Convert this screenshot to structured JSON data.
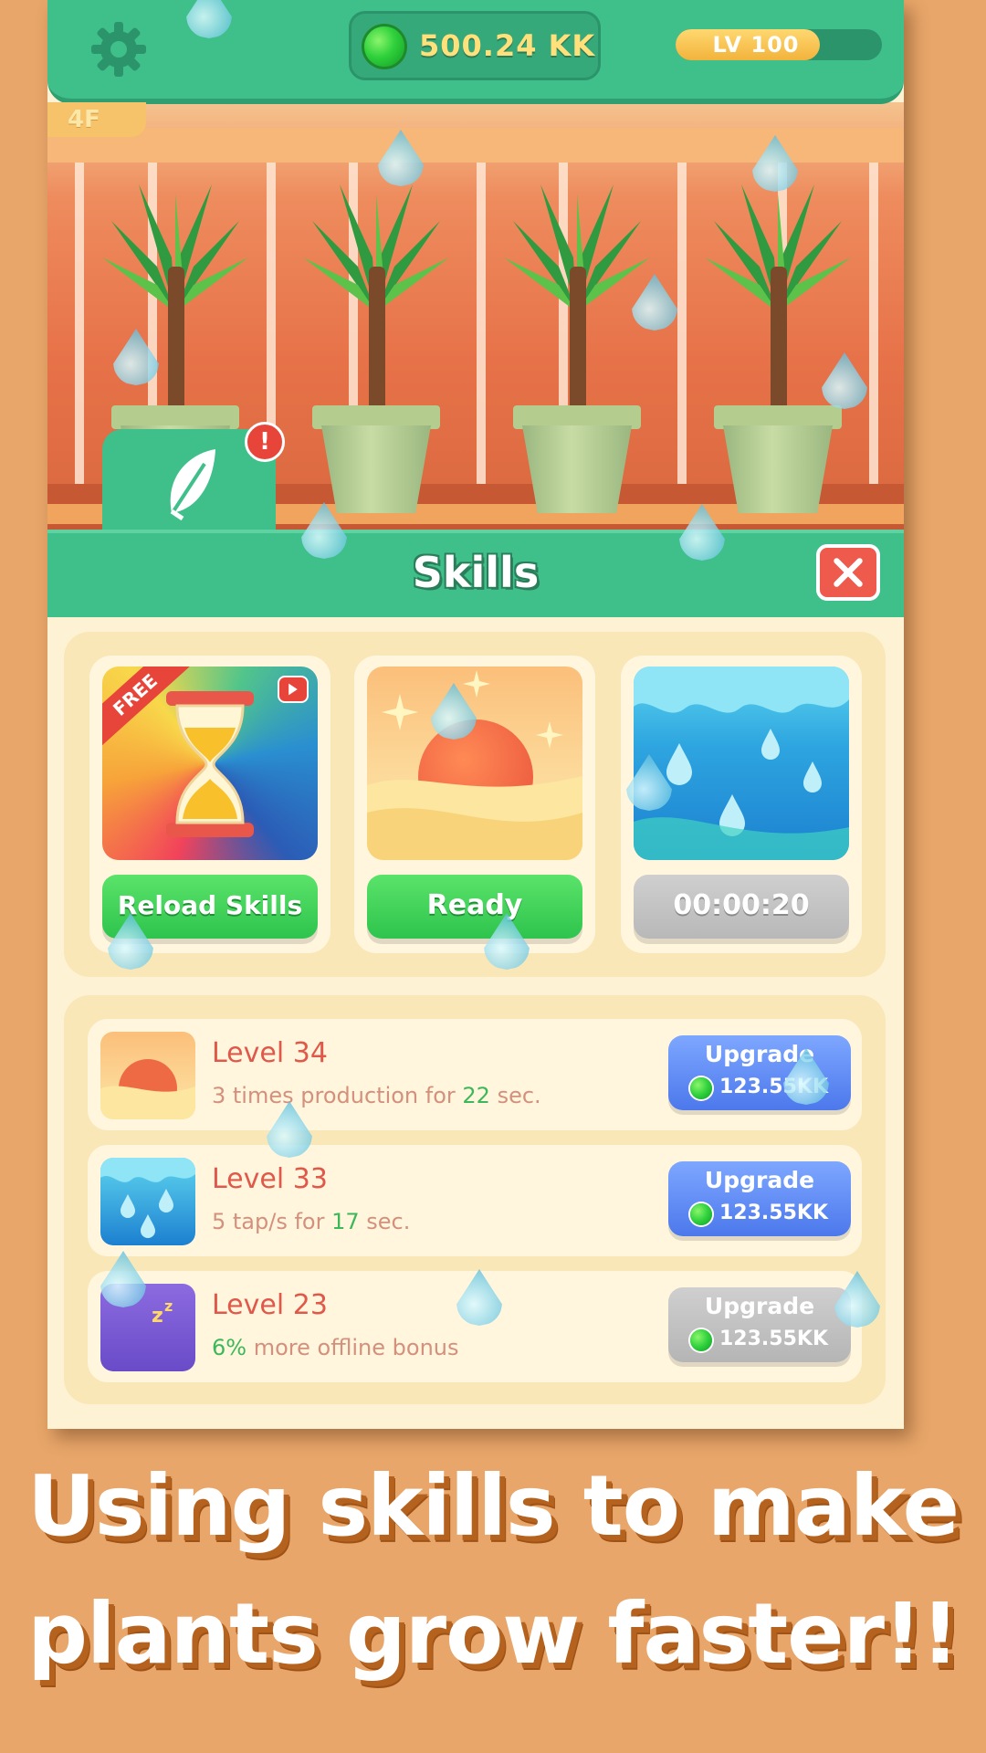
{
  "topbar": {
    "settings_icon": "gear-icon",
    "currency_value": "500.24 KK",
    "level_label": "LV 100",
    "level_progress": 0.7
  },
  "floor": {
    "label": "4F"
  },
  "skills_header": {
    "title": "Skills",
    "close_icon": "close-icon",
    "tab_icon": "leaf-icon",
    "alert": "!"
  },
  "skill_cards": [
    {
      "name": "reload-skills",
      "ribbon": "FREE",
      "button_label": "Reload Skills",
      "state": "active"
    },
    {
      "name": "sun-skill",
      "button_label": "Ready",
      "state": "active"
    },
    {
      "name": "rain-skill",
      "button_label": "00:00:20",
      "state": "cooldown"
    }
  ],
  "upgrades": [
    {
      "level": "Level 34",
      "desc_prefix": "3 times production for ",
      "desc_value": "22",
      "desc_suffix": " sec.",
      "button_label": "Upgrade",
      "cost": "123.55KK",
      "state": "enabled"
    },
    {
      "level": "Level 33",
      "desc_prefix": "5 tap/s for ",
      "desc_value": "17",
      "desc_suffix": " sec.",
      "button_label": "Upgrade",
      "cost": "123.55KK",
      "state": "enabled"
    },
    {
      "level": "Level 23",
      "desc_prefix": "",
      "desc_value": "6%",
      "desc_suffix": " more offline bonus",
      "button_label": "Upgrade",
      "cost": "123.55KK",
      "state": "disabled"
    }
  ],
  "caption": {
    "line1": "Using skills to make",
    "line2": "plants grow faster!!"
  },
  "colors": {
    "background": "#E8A66A",
    "primary_green": "#3FBF8A",
    "upgrade_blue": "#4C78EC",
    "level_text_red": "#E0584A"
  }
}
